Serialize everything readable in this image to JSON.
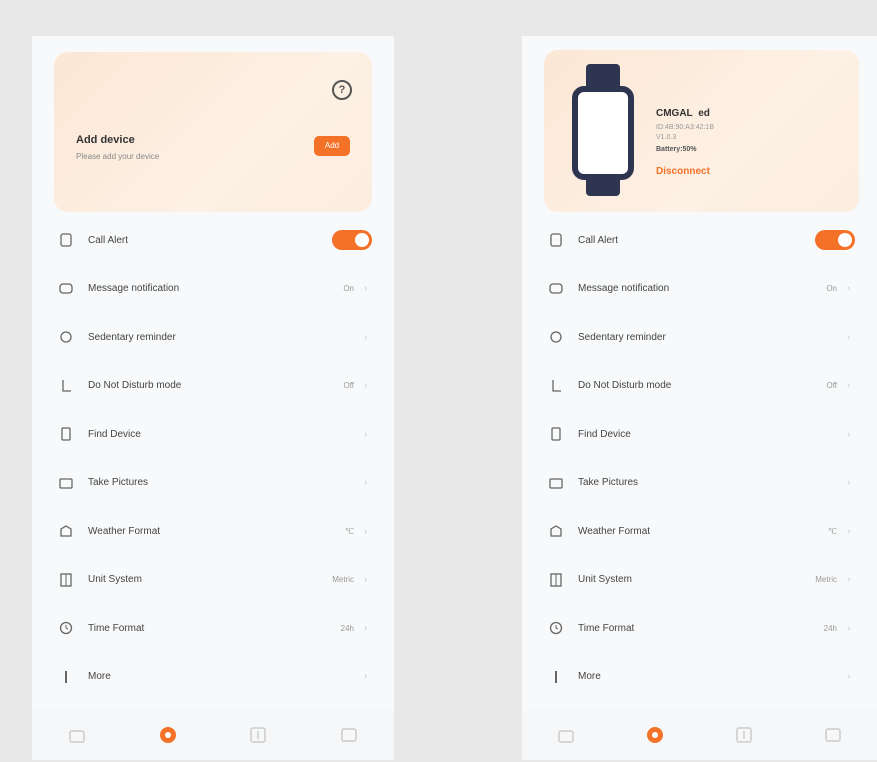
{
  "colors": {
    "accent": "#f47128",
    "watch": "#2e3550",
    "card": "#fbe7d5"
  },
  "left": {
    "help_icon": "?",
    "add_device_title": "Add device",
    "add_device_subtitle": "Please add your device",
    "add_button": "Add"
  },
  "right": {
    "device_name": "CMGAL  ed",
    "device_mac": "ID:4B:90:A3:42:1B",
    "device_version": "V1.0.3",
    "battery": "Battery:50%",
    "disconnect": "Disconnect"
  },
  "menu": [
    {
      "label": "Call Alert",
      "value": "",
      "type": "toggle",
      "icon": "phone-icon"
    },
    {
      "label": "Message notification",
      "value": "On",
      "type": "link",
      "icon": "message-icon"
    },
    {
      "label": "Sedentary reminder",
      "value": "",
      "type": "link",
      "icon": "sedentary-icon"
    },
    {
      "label": "Do Not Disturb mode",
      "value": "Off",
      "type": "link",
      "icon": "moon-icon"
    },
    {
      "label": "Find Device",
      "value": "",
      "type": "link",
      "icon": "find-device-icon"
    },
    {
      "label": "Take Pictures",
      "value": "",
      "type": "link",
      "icon": "camera-icon"
    },
    {
      "label": "Weather Format",
      "value": "℃",
      "type": "link",
      "icon": "weather-icon"
    },
    {
      "label": "Unit System",
      "value": "Metric",
      "type": "link",
      "icon": "ruler-icon"
    },
    {
      "label": "Time Format",
      "value": "24h",
      "type": "link",
      "icon": "clock-icon"
    },
    {
      "label": "More",
      "value": "",
      "type": "link",
      "icon": "more-icon"
    }
  ],
  "tabs": [
    {
      "icon": "home-icon",
      "active": false
    },
    {
      "icon": "device-icon",
      "active": true
    },
    {
      "icon": "data-icon",
      "active": false
    },
    {
      "icon": "profile-icon",
      "active": false
    }
  ]
}
